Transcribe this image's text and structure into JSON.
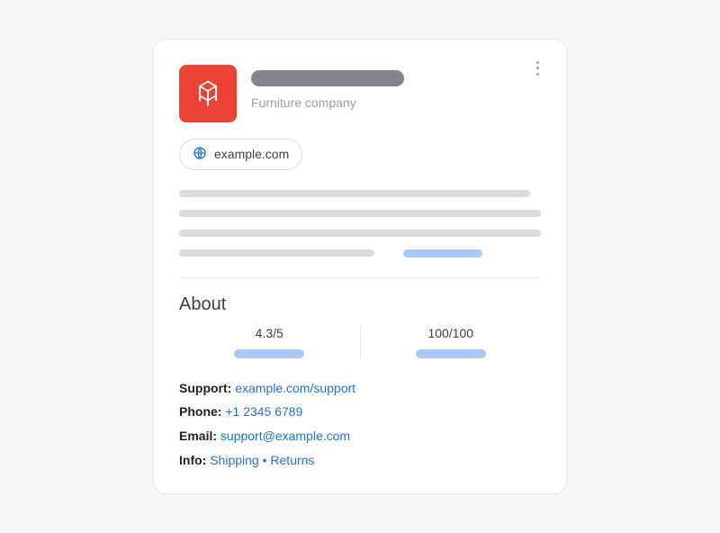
{
  "header": {
    "subtitle": "Furniture company",
    "site_chip": "example.com"
  },
  "about": {
    "title": "About",
    "rating1": "4.3/5",
    "rating2": "100/100"
  },
  "contact": {
    "support_label": "Support:",
    "support_value": "example.com/support",
    "phone_label": "Phone:",
    "phone_value": "+1 2345 6789",
    "email_label": "Email:",
    "email_value": "support@example.com",
    "info_label": "Info:",
    "info_shipping": "Shipping",
    "info_sep": "•",
    "info_returns": "Returns"
  }
}
